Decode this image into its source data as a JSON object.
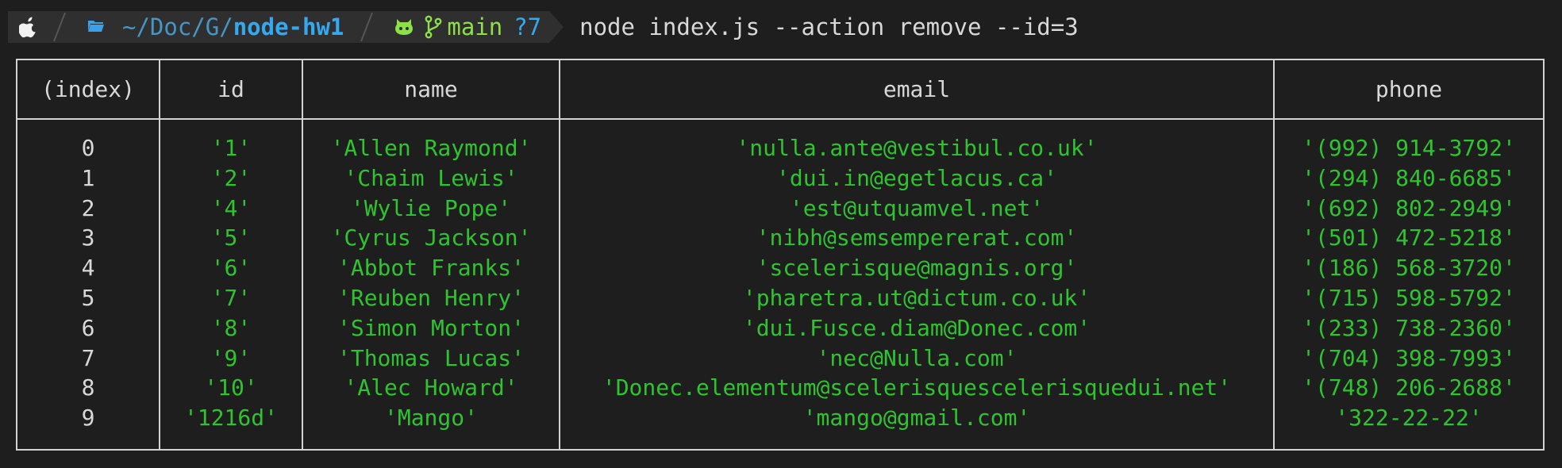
{
  "prompt": {
    "dir_prefix": "~/Doc/G/",
    "dir_name": "node-hw1",
    "branch": "main",
    "git_status": "?7",
    "command": "node index.js --action remove --id=3",
    "icons": [
      "apple-icon",
      "folder-icon",
      "github-icon",
      "git-branch-icon"
    ]
  },
  "table": {
    "columns": [
      "(index)",
      "id",
      "name",
      "email",
      "phone"
    ],
    "rows": [
      {
        "index": "0",
        "id": "'1'",
        "name": "'Allen Raymond'",
        "email": "'nulla.ante@vestibul.co.uk'",
        "phone": "'(992) 914-3792'"
      },
      {
        "index": "1",
        "id": "'2'",
        "name": "'Chaim Lewis'",
        "email": "'dui.in@egetlacus.ca'",
        "phone": "'(294) 840-6685'"
      },
      {
        "index": "2",
        "id": "'4'",
        "name": "'Wylie Pope'",
        "email": "'est@utquamvel.net'",
        "phone": "'(692) 802-2949'"
      },
      {
        "index": "3",
        "id": "'5'",
        "name": "'Cyrus Jackson'",
        "email": "'nibh@semsempererat.com'",
        "phone": "'(501) 472-5218'"
      },
      {
        "index": "4",
        "id": "'6'",
        "name": "'Abbot Franks'",
        "email": "'scelerisque@magnis.org'",
        "phone": "'(186) 568-3720'"
      },
      {
        "index": "5",
        "id": "'7'",
        "name": "'Reuben Henry'",
        "email": "'pharetra.ut@dictum.co.uk'",
        "phone": "'(715) 598-5792'"
      },
      {
        "index": "6",
        "id": "'8'",
        "name": "'Simon Morton'",
        "email": "'dui.Fusce.diam@Donec.com'",
        "phone": "'(233) 738-2360'"
      },
      {
        "index": "7",
        "id": "'9'",
        "name": "'Thomas Lucas'",
        "email": "'nec@Nulla.com'",
        "phone": "'(704) 398-7993'"
      },
      {
        "index": "8",
        "id": "'10'",
        "name": "'Alec Howard'",
        "email": "'Donec.elementum@scelerisquescelerisquedui.net'",
        "phone": "'(748) 206-2688'"
      },
      {
        "index": "9",
        "id": "'1216d'",
        "name": "'Mango'",
        "email": "'mango@gmail.com'",
        "phone": "'322-22-22'"
      }
    ]
  },
  "colors": {
    "background": "#1e1e1e",
    "string_value": "#2fc42f",
    "border": "#d2d2d2",
    "branch": "#8ee04a",
    "directory": "#35a9f0"
  }
}
